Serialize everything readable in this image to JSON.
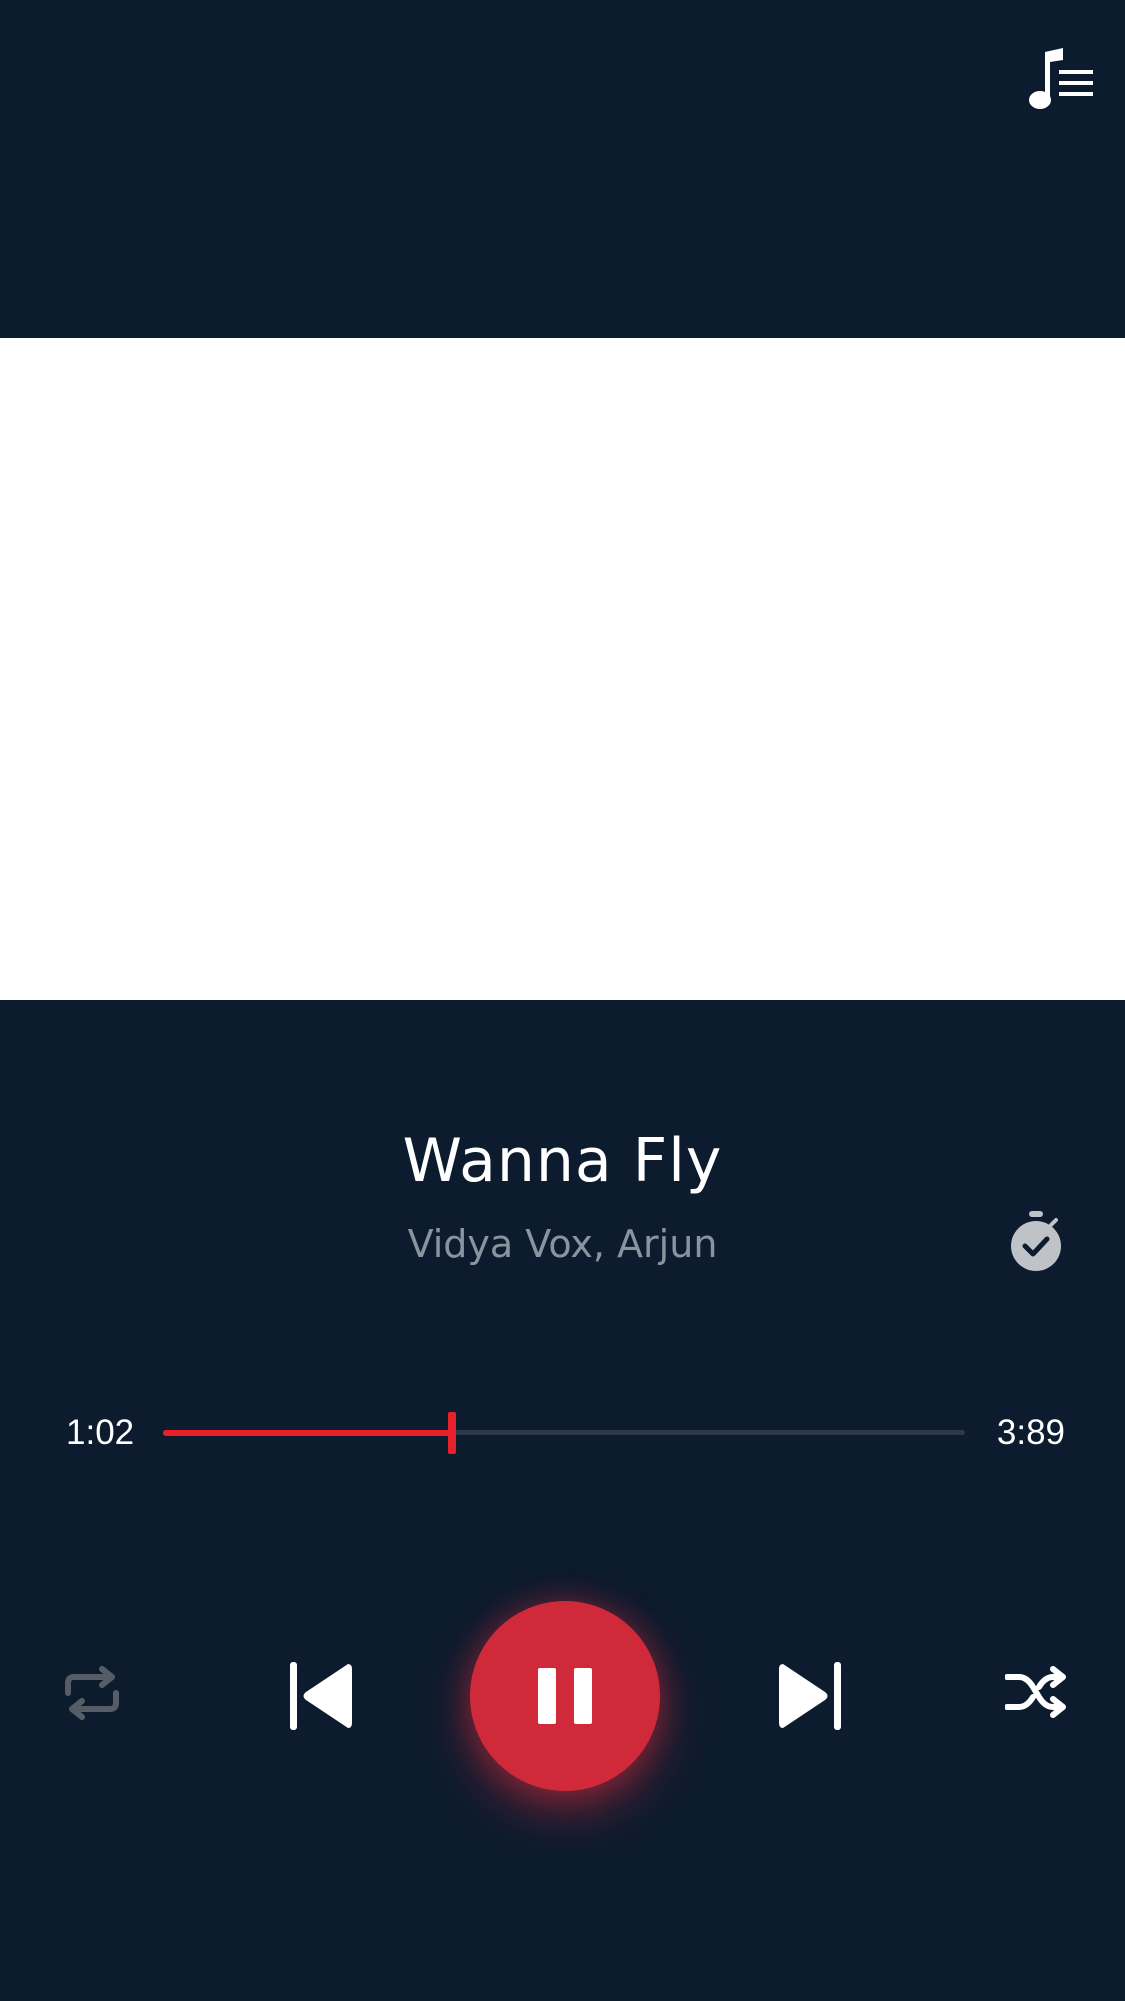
{
  "header": {
    "playlist_icon": "music-note-list-icon"
  },
  "album_art": {
    "background": "#ffffff"
  },
  "track": {
    "title": "Wanna Fly",
    "artist": "Vidya Vox, Arjun",
    "timer_icon": "stopwatch-check-icon"
  },
  "progress": {
    "elapsed": "1:02",
    "total": "3:89",
    "fraction": 0.36,
    "fill_color": "#e8202a"
  },
  "controls": {
    "repeat_icon": "repeat-icon",
    "previous_icon": "skip-previous-icon",
    "pause_icon": "pause-icon",
    "next_icon": "skip-next-icon",
    "shuffle_icon": "shuffle-icon",
    "accent_color": "#d02a3a"
  },
  "theme": {
    "background": "#0c1b2e"
  }
}
